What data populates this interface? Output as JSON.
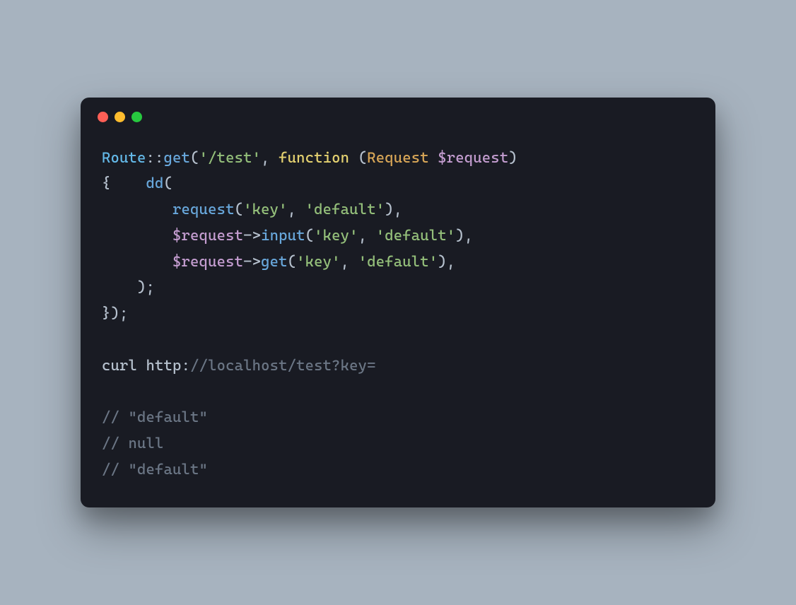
{
  "code": {
    "line1": {
      "route": "Route",
      "dcolon": "::",
      "get": "get",
      "open": "(",
      "path": "'/test'",
      "comma": ", ",
      "function": "function",
      "space": " ",
      "popen": "(",
      "request_type": "Request",
      "space2": " ",
      "var": "$request",
      "pclose": ")"
    },
    "line2": {
      "brace": "{",
      "indent": "    ",
      "dd": "dd",
      "open": "("
    },
    "line3": {
      "indent": "        ",
      "request": "request",
      "open": "(",
      "key": "'key'",
      "comma": ", ",
      "default": "'default'",
      "close": ")",
      "trailing": ","
    },
    "line4": {
      "indent": "        ",
      "var": "$request",
      "arrow": "->",
      "input": "input",
      "open": "(",
      "key": "'key'",
      "comma": ", ",
      "default": "'default'",
      "close": ")",
      "trailing": ","
    },
    "line5": {
      "indent": "        ",
      "var": "$request",
      "arrow": "->",
      "get": "get",
      "open": "(",
      "key": "'key'",
      "comma": ", ",
      "default": "'default'",
      "close": ")",
      "trailing": ","
    },
    "line6": {
      "indent": "    ",
      "close": ");"
    },
    "line7": {
      "close": "});"
    },
    "line8": "",
    "line9": {
      "curl": "curl",
      "space": " ",
      "http": "http",
      "colon": ":",
      "url": "//localhost/test?key="
    },
    "line10": "",
    "line11": "// \"default\"",
    "line12": "// null",
    "line13": "// \"default\""
  }
}
